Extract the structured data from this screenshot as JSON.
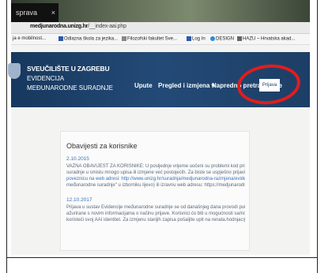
{
  "browser": {
    "tab_title": "sprava",
    "tab_close": "×",
    "address_prefix": "",
    "address_host": "medjunarodna.unizg.hr",
    "address_path": "/__index-aai.php",
    "bookmarks": [
      "ja e mobilnost...",
      "Odlazna škola za jezika...",
      "Filozofski fakultet Sve...",
      "Log In",
      "DESIGN",
      "HAZU – Hrvatska akad..."
    ]
  },
  "site": {
    "university_line1": "SVEUČILIŠTE U ZAGREBU",
    "university_line2": "EVIDENCIJA",
    "university_line3": "MEĐUNARODNE SURADNJE",
    "nav": [
      "Upute",
      "Pregled i izmjena ▾",
      "Napredno pretraživanje"
    ],
    "login_button": "Prijava"
  },
  "notices": {
    "title": "Obavijesti za korisnike",
    "entries": [
      {
        "date": "2.10.2015",
        "lines": [
          "VAŽNA OBAVIJEST ZA KORISNIKE: U posljednje vrijeme uočeni su problemi kod prijave u sustav Evidencije međunarodne",
          "suradnje u smislu mnogo upisa ili izmjene već postojećih. Za biste se uspješno prijavili u Evidenciju, potrebno je koristiti isključivo",
          "poveznicu na web adresi: http://www.unizg.hr/suradnja/medjunarodna-razmjena/evidencija (link \"Evidencija",
          "međunarodne suradnje\" u izborniku lijevo) ili izravnu web adresu: https://medjunarodna.unizg.hr"
        ]
      },
      {
        "date": "12.10.2017",
        "lines": [
          "Prijava u sustav Evidencije međunarodne suradnje se od današnjeg dana provodi putem AAI identiteta. Upute za korisnike su",
          "ažurirane s novim informacijama o načinu prijave. Korisnici ćo biti u mogućnosti samostalno izmijeniti sve zapise koje unesu",
          "koristeći svoj AAI identitet. Za izmjenu starijih zapisa pošaljite upit na renata.hodnjac@unizg.hr s opisom potrebnih izmjena."
        ]
      }
    ]
  }
}
